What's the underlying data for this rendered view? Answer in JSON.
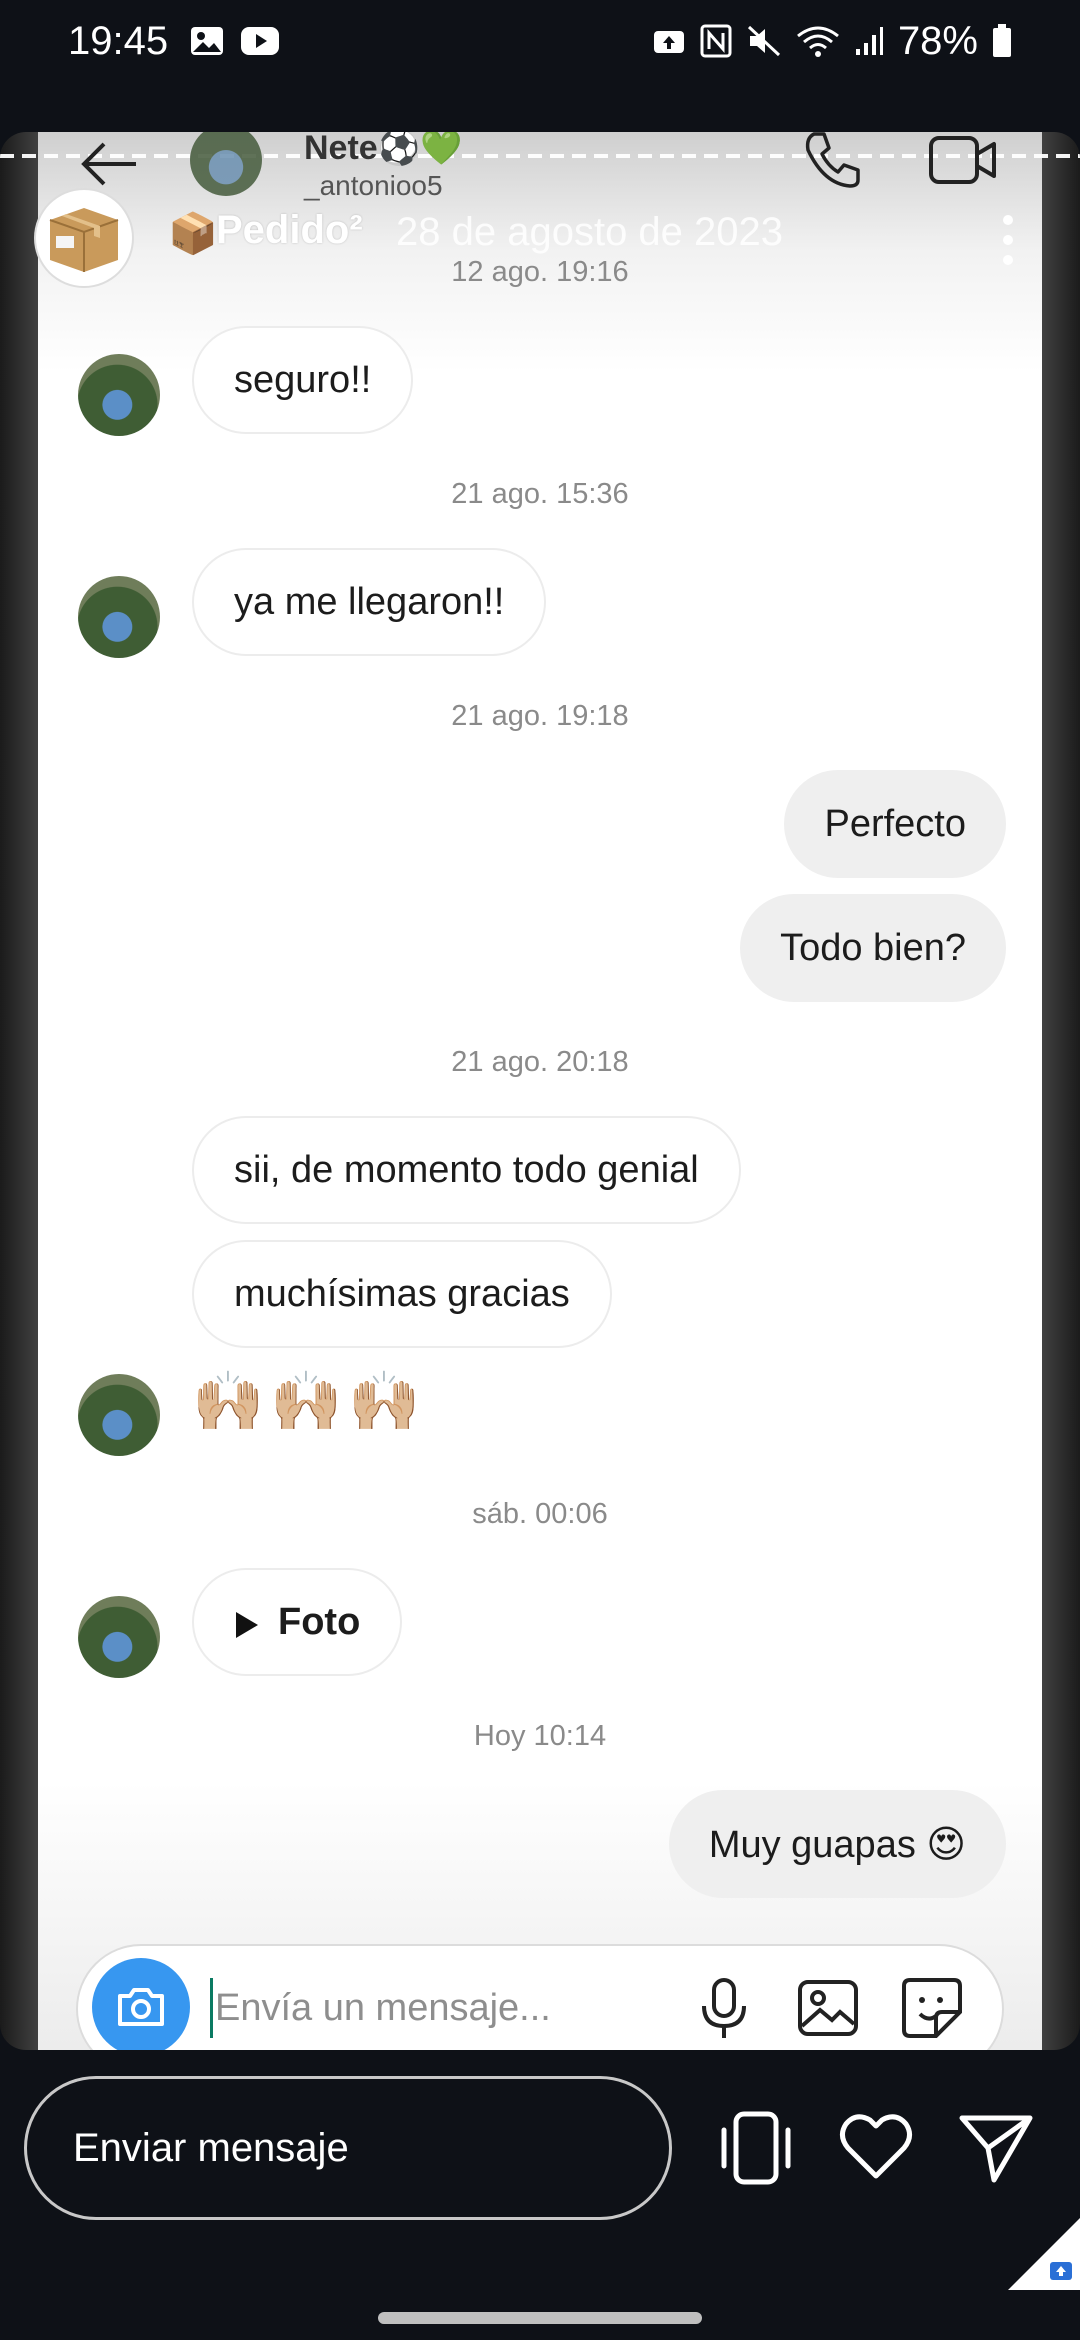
{
  "status_bar": {
    "time": "19:45",
    "battery": "78%",
    "icons_left": [
      "gallery-icon",
      "youtube-icon"
    ],
    "icons_right": [
      "cloud-upload-icon",
      "nfc-icon",
      "mute-icon",
      "wifi-icon",
      "signal-icon",
      "battery-icon"
    ]
  },
  "chat_header": {
    "name": "Nete⚽💚",
    "username": "_antonioo5"
  },
  "story": {
    "label": "Pedido²",
    "box_emoji": "📦",
    "date": "28 de agosto de 2023"
  },
  "messages": [
    {
      "type": "timestamp",
      "text": "12 ago. 19:16"
    },
    {
      "type": "in",
      "text": "seguro!!"
    },
    {
      "type": "timestamp",
      "text": "21 ago. 15:36"
    },
    {
      "type": "in",
      "text": "ya me llegaron!!"
    },
    {
      "type": "timestamp",
      "text": "21 ago. 19:18"
    },
    {
      "type": "out",
      "text": "Perfecto"
    },
    {
      "type": "out",
      "text": "Todo bien?"
    },
    {
      "type": "timestamp",
      "text": "21 ago. 20:18"
    },
    {
      "type": "in",
      "text": "sii, de momento todo genial"
    },
    {
      "type": "in",
      "text": "muchísimas gracias"
    },
    {
      "type": "emoji",
      "text": "🙌🏼🙌🏼🙌🏼"
    },
    {
      "type": "timestamp",
      "text": "sáb. 00:06"
    },
    {
      "type": "in",
      "text": "Foto"
    },
    {
      "type": "timestamp",
      "text": "Hoy 10:14"
    },
    {
      "type": "out",
      "text": "Muy guapas 😍"
    }
  ],
  "input": {
    "placeholder": "Envía un mensaje..."
  },
  "reply": {
    "placeholder": "Enviar mensaje"
  },
  "colors": {
    "camera_button": "#3797f0",
    "background_dark": "#0e1117"
  }
}
